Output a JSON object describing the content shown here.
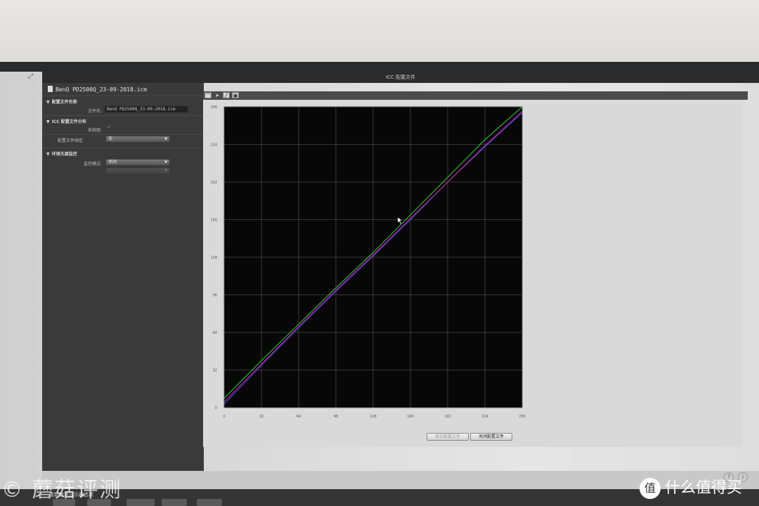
{
  "window": {
    "title": "ICC 配置文件"
  },
  "file": {
    "name": "BenQ PD2500Q_23-09-2018.icm"
  },
  "sections": {
    "profile_name": {
      "title": "配置文件名称",
      "filename_label": "文件名:",
      "filename_value": "BenQ PD2500Q_23-09-2018.icm"
    },
    "icc_distribution": {
      "title": "ICC 配置文件分布",
      "system_default_label": "系统级:",
      "system_default_checked": true,
      "profile_binding_label": "配置文件绑定",
      "profile_binding_value": "无"
    },
    "ambient": {
      "title": "环境光源监控",
      "mode_label": "监控模式:",
      "mode_value": "关闭",
      "sub_label": "",
      "sub_value": ""
    }
  },
  "toolbar": {
    "icons": [
      "curve-icon",
      "arrow-icon",
      "gamma-icon",
      "image-icon"
    ]
  },
  "buttons": {
    "save": "保存配置文件",
    "close": "关闭配置文件"
  },
  "dock": {
    "label": "重新校准显示器选项"
  },
  "watermark": {
    "left": "© 蘑菇评测",
    "right": "什么值得买",
    "logo": "值"
  },
  "chart_data": {
    "type": "line",
    "title": "",
    "xlabel": "",
    "ylabel": "",
    "xlim": [
      0,
      256
    ],
    "ylim": [
      0,
      256
    ],
    "x_ticks": [
      0,
      32,
      64,
      96,
      128,
      160,
      192,
      224,
      256
    ],
    "y_ticks": [
      0,
      32,
      64,
      96,
      128,
      160,
      192,
      224,
      256
    ],
    "grid": true,
    "series": [
      {
        "color": "#3ad13a",
        "x": [
          0,
          32,
          64,
          96,
          128,
          160,
          192,
          224,
          256
        ],
        "y": [
          8,
          40,
          71,
          102,
          132,
          164,
          196,
          228,
          256
        ]
      },
      {
        "color": "#4a4aff",
        "x": [
          0,
          32,
          64,
          96,
          128,
          160,
          192,
          224,
          256
        ],
        "y": [
          3,
          36,
          68,
          99,
          129,
          160,
          192,
          222,
          251
        ]
      },
      {
        "color": "#c82b8a",
        "x": [
          0,
          32,
          64,
          96,
          128,
          160,
          192,
          224,
          256
        ],
        "y": [
          5,
          37,
          69,
          100,
          130,
          161,
          192,
          223,
          252
        ]
      }
    ]
  }
}
